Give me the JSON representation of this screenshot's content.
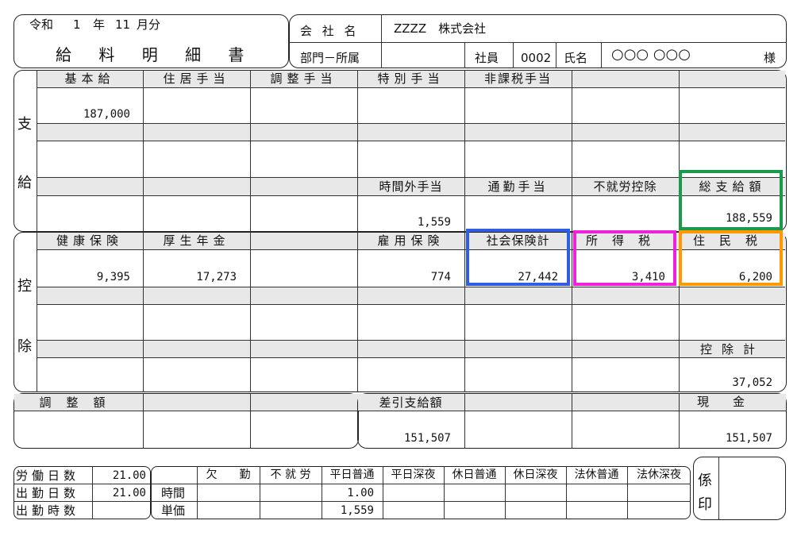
{
  "header": {
    "era": "令和",
    "year": "1",
    "year_unit": "年",
    "month": "11",
    "month_unit": "月分",
    "title": "給 料 明 細 書",
    "company_label": "会 社 名",
    "company_name": "ZZZZ　株式会社",
    "dept_label": "部門－所属",
    "employee_label": "社員",
    "employee_no": "0002",
    "name_label": "氏名",
    "name_value": "○○○ ○○○",
    "honorific": "様"
  },
  "payments": {
    "side_label_1": "支",
    "side_label_2": "給",
    "headers": [
      "基本給",
      "住居手当",
      "調整手当",
      "特別手当",
      "非課税手当",
      "",
      ""
    ],
    "row1_values": [
      "187,000",
      "",
      "",
      "",
      "",
      "",
      ""
    ],
    "headers2": [
      "",
      "",
      "",
      "時間外手当",
      "通勤手当",
      "不就労控除",
      "総支給額"
    ],
    "row2_values": [
      "",
      "",
      "",
      "1,559",
      "",
      "",
      "188,559"
    ]
  },
  "deductions": {
    "side_label_1": "控",
    "side_label_2": "除",
    "headers": [
      "健康保険",
      "厚生年金",
      "",
      "雇用保険",
      "社会保険計",
      "所得税",
      "住民税"
    ],
    "row1_values": [
      "9,395",
      "17,273",
      "",
      "774",
      "27,442",
      "3,410",
      "6,200"
    ],
    "headers2": [
      "",
      "",
      "",
      "",
      "",
      "",
      "控除計"
    ],
    "row2_values": [
      "",
      "",
      "",
      "",
      "",
      "",
      "37,052"
    ]
  },
  "summary": {
    "adjust_label": "調　整　額",
    "net_label": "差引支給額",
    "net_value": "151,507",
    "cash_label": "現　　金",
    "cash_value": "151,507"
  },
  "attendance": {
    "rows": [
      {
        "label": "労働日数",
        "value": "21.00"
      },
      {
        "label": "出勤日数",
        "value": "21.00"
      },
      {
        "label": "出勤時数",
        "value": ""
      }
    ],
    "col_headers": [
      "欠　　勤",
      "不 就 労",
      "平日普通",
      "平日深夜",
      "休日普通",
      "休日深夜",
      "法休普通",
      "法休深夜"
    ],
    "row_labels": [
      "時間",
      "単価"
    ],
    "hours_values": [
      "",
      "",
      "1.00",
      "",
      "",
      "",
      "",
      ""
    ],
    "price_values": [
      "",
      "",
      "1,559",
      "",
      "",
      "",
      "",
      ""
    ]
  },
  "stamp": {
    "label_1": "係",
    "label_2": "印"
  },
  "highlight_colors": {
    "total_pay": "#1a9a4a",
    "social_insurance": "#2f5de6",
    "income_tax": "#ee22dd",
    "resident_tax": "#ff9900"
  }
}
